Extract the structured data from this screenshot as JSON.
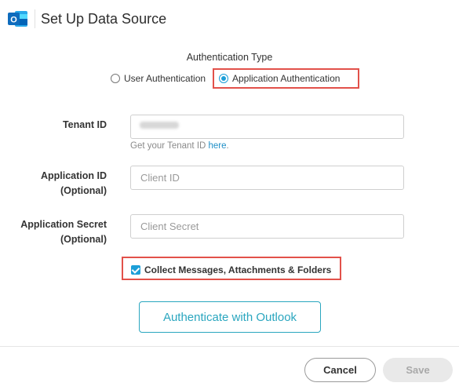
{
  "header": {
    "title": "Set Up Data Source",
    "logo_icon": "outlook-logo-icon",
    "logo_letter": "O",
    "brand_color": "#0f6cbd"
  },
  "auth_type": {
    "label": "Authentication Type",
    "options": [
      {
        "label": "User Authentication",
        "selected": false
      },
      {
        "label": "Application Authentication",
        "selected": true
      }
    ]
  },
  "form": {
    "tenant_id": {
      "label": "Tenant ID",
      "value": "",
      "hint_prefix": "Get your Tenant ID ",
      "hint_link": "here",
      "hint_suffix": "."
    },
    "application_id": {
      "label_line1": "Application ID",
      "label_line2": "(Optional)",
      "placeholder": "Client ID"
    },
    "application_secret": {
      "label_line1": "Application Secret",
      "label_line2": "(Optional)",
      "placeholder": "Client Secret"
    },
    "collect_option": {
      "label": "Collect Messages, Attachments & Folders",
      "checked": true
    }
  },
  "actions": {
    "authenticate_label": "Authenticate with Outlook",
    "cancel_label": "Cancel",
    "save_label": "Save",
    "save_enabled": false
  },
  "colors": {
    "accent": "#1c9fd8",
    "teal": "#2aa6bf",
    "highlight_border": "#e2514a"
  }
}
